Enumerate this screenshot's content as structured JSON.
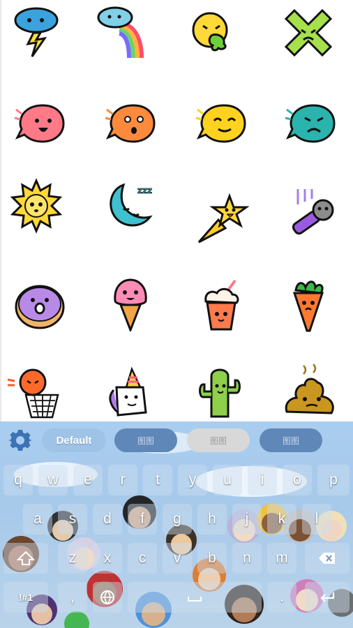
{
  "stickers": [
    {
      "name": "storm-cloud-sticker"
    },
    {
      "name": "rainbow-cloud-sticker"
    },
    {
      "name": "sick-face-sticker"
    },
    {
      "name": "x-face-sticker"
    },
    {
      "name": "pink-bubble-sticker"
    },
    {
      "name": "orange-bubble-sticker"
    },
    {
      "name": "yellow-bubble-sticker"
    },
    {
      "name": "teal-bubble-sticker"
    },
    {
      "name": "sun-sticker"
    },
    {
      "name": "moon-sticker"
    },
    {
      "name": "shooting-star-sticker"
    },
    {
      "name": "microphone-sticker"
    },
    {
      "name": "donut-sticker"
    },
    {
      "name": "ice-cream-sticker"
    },
    {
      "name": "milkshake-sticker"
    },
    {
      "name": "carrot-sticker"
    },
    {
      "name": "basketball-sticker"
    },
    {
      "name": "unicorn-sticker"
    },
    {
      "name": "cactus-sticker"
    },
    {
      "name": "poop-sticker"
    }
  ],
  "toolbar": {
    "default_label": "Default",
    "slot1_label": "图图",
    "slot2_label": "图图",
    "slot3_label": "图图",
    "settings_icon": "gear-icon"
  },
  "keys": {
    "row1": [
      "q",
      "w",
      "e",
      "r",
      "t",
      "y",
      "u",
      "i",
      "o",
      "p"
    ],
    "row2": [
      "a",
      "s",
      "d",
      "f",
      "g",
      "h",
      "j",
      "k",
      "l"
    ],
    "row3": [
      "z",
      "x",
      "c",
      "v",
      "b",
      "n",
      "m"
    ],
    "symbols_label": "!#1",
    "comma_label": ",",
    "period_label": ".",
    "icons": {
      "shift": "shift-icon",
      "backspace": "backspace-icon",
      "globe": "globe-icon",
      "space": "space-icon",
      "enter": "enter-icon"
    }
  },
  "colors": {
    "keyboard_bg": "#a9cdf0",
    "pill_active": "#9fc3e6",
    "pill_slot": "#5f87b7"
  }
}
